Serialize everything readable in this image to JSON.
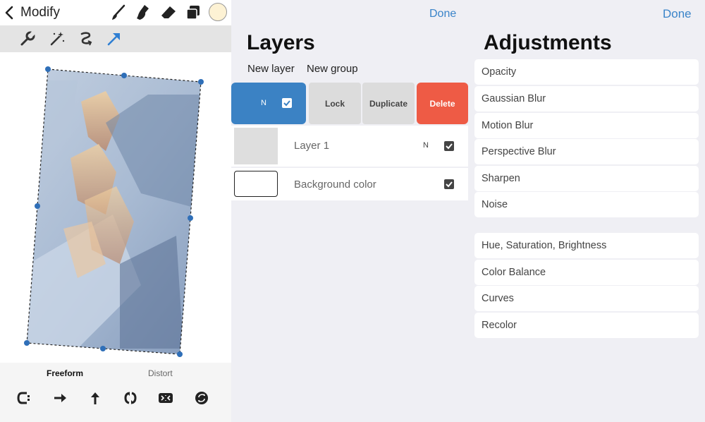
{
  "modify": {
    "back_icon": "chevron-left-icon",
    "title": "Modify",
    "toolbar_icons": [
      "brush-icon",
      "smudge-icon",
      "eraser-icon",
      "layers-icon"
    ],
    "color_swatch": "#fdf2d4",
    "tool_icons": [
      "wrench-icon",
      "magic-wand-icon",
      "selection-icon",
      "transform-arrow-icon"
    ],
    "active_tool": "transform-arrow-icon",
    "modes": {
      "freeform": "Freeform",
      "distort": "Distort"
    },
    "active_mode": "Freeform",
    "bottom_icons": [
      "magnetics-icon",
      "flip-horizontal-icon",
      "flip-vertical-icon",
      "rotate-45-icon",
      "fit-to-screen-icon",
      "reset-icon"
    ]
  },
  "layers": {
    "done_label": "Done",
    "title": "Layers",
    "new_layer_label": "New layer",
    "new_group_label": "New group",
    "selected_blend": "N",
    "actions": {
      "lock": "Lock",
      "duplicate": "Duplicate",
      "delete": "Delete"
    },
    "rows": [
      {
        "name": "Layer 1",
        "blend": "N",
        "visible": true
      },
      {
        "name": "Background color",
        "visible": true
      }
    ],
    "accent": "#3b82c4",
    "delete_color": "#ee5b45"
  },
  "adjustments": {
    "done_label": "Done",
    "title": "Adjustments",
    "group1": [
      "Opacity",
      "Gaussian Blur",
      "Motion Blur",
      "Perspective Blur",
      "Sharpen",
      "Noise"
    ],
    "group2": [
      "Hue, Saturation, Brightness",
      "Color Balance",
      "Curves",
      "Recolor"
    ]
  }
}
